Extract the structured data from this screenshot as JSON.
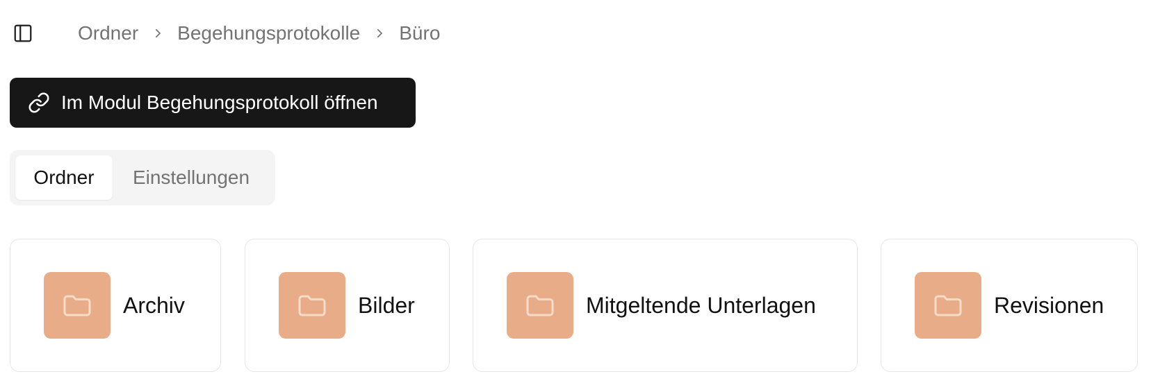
{
  "header": {
    "breadcrumb": [
      {
        "label": "Ordner"
      },
      {
        "label": "Begehungsprotokolle"
      },
      {
        "label": "Büro"
      }
    ]
  },
  "actions": {
    "open_module_label": "Im Modul Begehungsprotokoll öffnen",
    "open_module_icon": "link-icon"
  },
  "tabs": [
    {
      "label": "Ordner",
      "active": true
    },
    {
      "label": "Einstellungen",
      "active": false
    }
  ],
  "folders": [
    {
      "label": "Archiv",
      "icon": "folder-icon"
    },
    {
      "label": "Bilder",
      "icon": "folder-icon"
    },
    {
      "label": "Mitgeltende Unterlagen",
      "icon": "folder-icon"
    },
    {
      "label": "Revisionen",
      "icon": "folder-icon"
    }
  ],
  "colors": {
    "primary_button_bg": "#171717",
    "folder_tile_bg": "#e8ac88",
    "tabs_bg": "#f4f4f5",
    "muted_text": "#737373"
  }
}
